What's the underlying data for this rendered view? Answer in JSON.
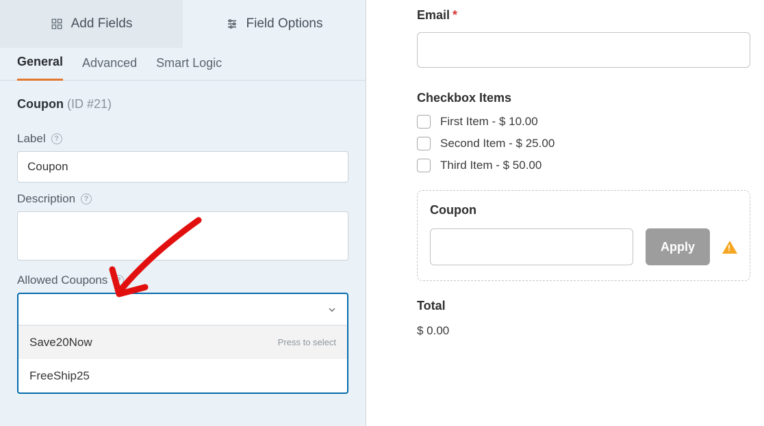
{
  "left_panel": {
    "primary_tabs": {
      "add_fields": "Add Fields",
      "field_options": "Field Options"
    },
    "sub_tabs": {
      "general": "General",
      "advanced": "Advanced",
      "smart_logic": "Smart Logic"
    },
    "field": {
      "name": "Coupon",
      "id_text": "(ID #21)"
    },
    "label_section": {
      "title": "Label",
      "value": "Coupon"
    },
    "description_section": {
      "title": "Description",
      "value": ""
    },
    "allowed_coupons": {
      "title": "Allowed Coupons",
      "press_hint": "Press to select",
      "options": [
        "Save20Now",
        "FreeShip25"
      ]
    }
  },
  "right_panel": {
    "email": {
      "label": "Email",
      "value": ""
    },
    "checkbox_items": {
      "label": "Checkbox Items",
      "items": [
        {
          "text": "First Item - $ 10.00"
        },
        {
          "text": "Second Item - $ 25.00"
        },
        {
          "text": "Third Item - $ 50.00"
        }
      ]
    },
    "coupon": {
      "label": "Coupon",
      "apply": "Apply",
      "value": ""
    },
    "total": {
      "label": "Total",
      "value": "$ 0.00"
    }
  }
}
